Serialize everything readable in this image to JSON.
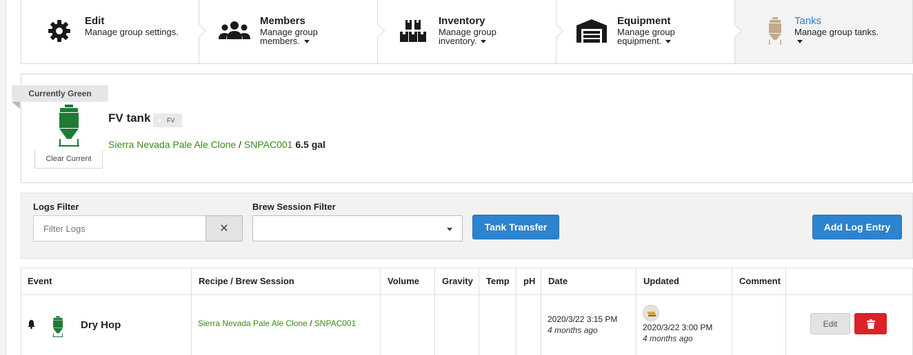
{
  "nav": {
    "steps": [
      {
        "title": "Edit",
        "desc_lines": [
          "Manage group settings."
        ],
        "icon": "gear-icon",
        "dropdown": false,
        "active": false
      },
      {
        "title": "Members",
        "desc_lines": [
          "Manage group",
          "members."
        ],
        "icon": "users-icon",
        "dropdown": true,
        "active": false
      },
      {
        "title": "Inventory",
        "desc_lines": [
          "Manage group",
          "inventory."
        ],
        "icon": "boxes-icon",
        "dropdown": true,
        "active": false
      },
      {
        "title": "Equipment",
        "desc_lines": [
          "Manage group",
          "equipment."
        ],
        "icon": "warehouse-icon",
        "dropdown": true,
        "active": false
      },
      {
        "title": "Tanks",
        "desc_lines": [
          "Manage group tanks."
        ],
        "icon": "tank-icon",
        "dropdown": true,
        "active": true
      }
    ]
  },
  "tank": {
    "ribbon": "Currently Green",
    "name": "FV tank",
    "tag": "FV",
    "clear_label": "Clear Current",
    "recipe": "Sierra Nevada Pale Ale Clone",
    "separator": " / ",
    "session": "SNPAC001",
    "volume": "6.5 gal"
  },
  "filters": {
    "logs_label": "Logs Filter",
    "logs_placeholder": "Filter Logs",
    "clear_glyph": "✕",
    "session_label": "Brew Session Filter",
    "session_value": "",
    "transfer_label": "Tank Transfer",
    "add_label": "Add Log Entry"
  },
  "table": {
    "headers": [
      "Event",
      "Recipe / Brew Session",
      "Volume",
      "Gravity",
      "Temp",
      "pH",
      "Date",
      "Updated",
      "Comment"
    ],
    "rows": [
      {
        "event": "Dry Hop",
        "recipe": "Sierra Nevada Pale Ale Clone",
        "separator": " / ",
        "session": "SNPAC001",
        "volume": "",
        "gravity": "",
        "temp": "",
        "ph": "",
        "date": "2020/3/22 3:15 PM",
        "date_rel": "4 months ago",
        "updated": "2020/3/22 3:00 PM",
        "updated_rel": "4 months ago",
        "comment": "",
        "edit_label": "Edit"
      }
    ]
  },
  "colors": {
    "accent_blue": "#2c83cf",
    "link_green": "#3b8a16",
    "tank_green": "#1f7a36",
    "delete_red": "#dc2127",
    "tank_tan": "#c2a98a"
  }
}
